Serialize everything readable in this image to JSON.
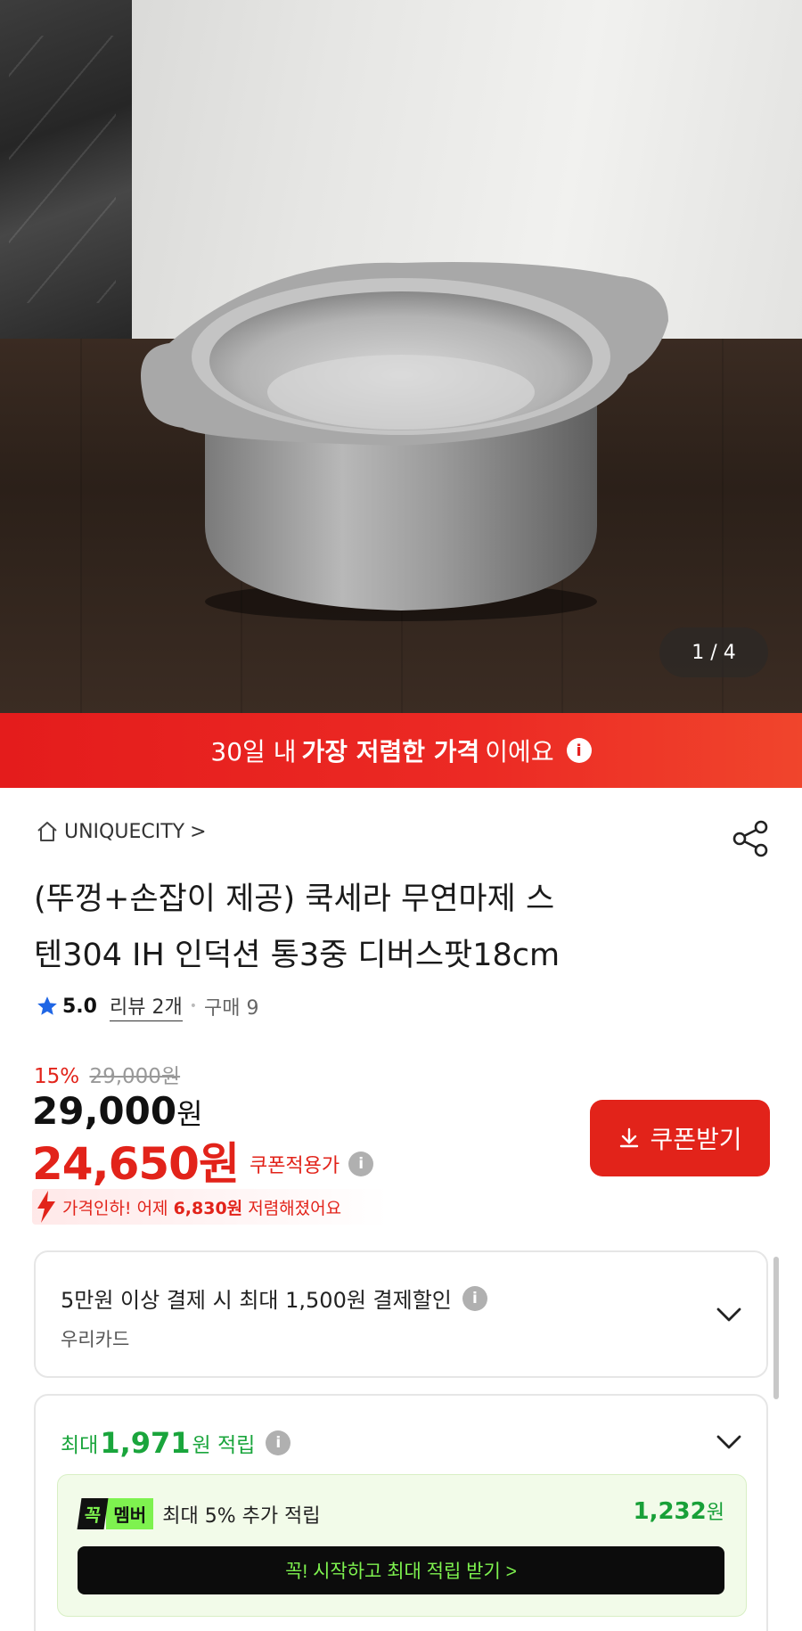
{
  "hero": {
    "image_alt": "stainless steel pot",
    "counter": "1 / 4"
  },
  "banner": {
    "prefix": "30일 내",
    "highlight": "가장 저렴한 가격",
    "suffix": "이에요",
    "info_icon": "info-icon"
  },
  "store": {
    "home_icon": "home-icon",
    "name": "UNIQUECITY",
    "chevron": ">"
  },
  "share_icon": "share-icon",
  "product": {
    "title_line1": "(뚜껑+손잡이 제공) 쿡세라 무연마제 스",
    "title_line2": "텐304 IH 인덕션 통3중 디버스팟18cm"
  },
  "rating": {
    "star_icon": "star-icon",
    "score": "5.0",
    "reviews": "리뷰 2개",
    "dot": "•",
    "purchases": "구매 9"
  },
  "price": {
    "discount_pct": "15%",
    "original": "29,000원",
    "current_amount": "29,000",
    "current_unit": "원",
    "coupon_amount": "24,650원",
    "coupon_label": "쿠폰적용가",
    "drop_prefix": "가격인하! 어제 ",
    "drop_amount": "6,830원",
    "drop_suffix": " 저렴해졌어요"
  },
  "coupon_button": {
    "icon": "download-icon",
    "label": "쿠폰받기"
  },
  "card_discount": {
    "line1": "5만원 이상 결제 시 최대 1,500원 결제할인",
    "line2": "우리카드"
  },
  "points": {
    "prefix": "최대",
    "amount": "1,971",
    "suffix": "원 적립",
    "member_badge1": "꼭",
    "member_badge2": "멤버",
    "member_text": "최대 5% 추가 적립",
    "member_amount": "1,232",
    "member_unit": "원",
    "cta": "꼭! 시작하고 최대 적립 받기  >"
  },
  "colors": {
    "accent_red": "#e2231a",
    "green": "#1aa53c",
    "lime": "#7ef24f"
  }
}
